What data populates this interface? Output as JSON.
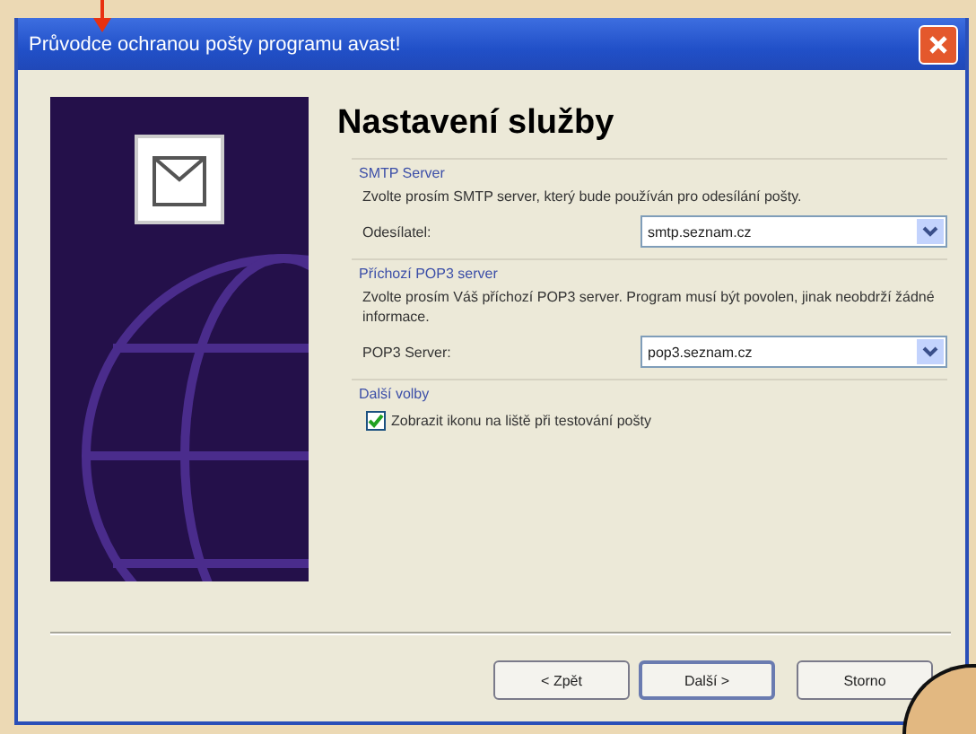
{
  "window": {
    "title": "Průvodce ochranou pošty programu avast!"
  },
  "heading": "Nastavení služby",
  "groups": [
    {
      "title": "SMTP Server",
      "description": "Zvolte prosím SMTP server, který bude používán pro odesílání pošty.",
      "kind": "select",
      "label": "Odesílatel:",
      "value": "smtp.seznam.cz"
    },
    {
      "title": "Příchozí POP3 server",
      "description": "Zvolte prosím Váš příchozí POP3 server. Program musí být povolen, jinak neobdrží žádné informace.",
      "kind": "select",
      "label": "POP3 Server:",
      "value": "pop3.seznam.cz"
    },
    {
      "title": "Další volby",
      "kind": "checkbox",
      "label": "Zobrazit ikonu na liště při testování pošty",
      "checked": true
    }
  ],
  "buttons": [
    "< Zpět",
    "Další >",
    "Storno"
  ]
}
